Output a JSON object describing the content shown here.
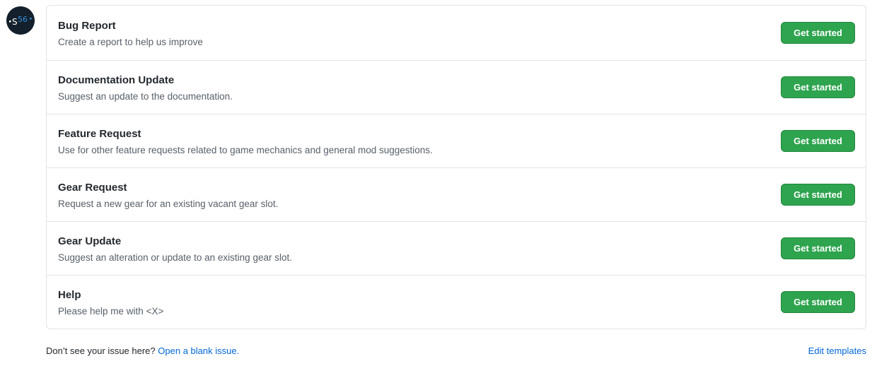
{
  "avatar": {
    "text": "RS56"
  },
  "templates": [
    {
      "title": "Bug Report",
      "description": "Create a report to help us improve",
      "button_label": "Get started"
    },
    {
      "title": "Documentation Update",
      "description": "Suggest an update to the documentation.",
      "button_label": "Get started"
    },
    {
      "title": "Feature Request",
      "description": "Use for other feature requests related to game mechanics and general mod suggestions.",
      "button_label": "Get started"
    },
    {
      "title": "Gear Request",
      "description": "Request a new gear for an existing vacant gear slot.",
      "button_label": "Get started"
    },
    {
      "title": "Gear Update",
      "description": "Suggest an alteration or update to an existing gear slot.",
      "button_label": "Get started"
    },
    {
      "title": "Help",
      "description": "Please help me with <X>",
      "button_label": "Get started"
    }
  ],
  "footer": {
    "prompt": "Don’t see your issue here?",
    "blank_issue_link": "Open a blank issue.",
    "edit_templates_link": "Edit templates"
  },
  "colors": {
    "button_bg": "#2ea44f",
    "link": "#0366d6",
    "border": "#e1e4e8"
  }
}
